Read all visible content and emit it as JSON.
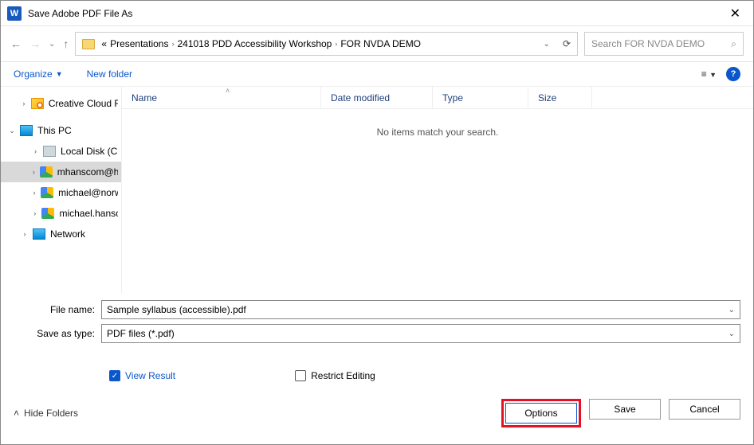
{
  "titlebar": {
    "title": "Save Adobe PDF File As"
  },
  "breadcrumb": {
    "prefix": "«",
    "items": [
      "Presentations",
      "241018 PDD Accessibility Workshop",
      "FOR NVDA DEMO"
    ]
  },
  "search": {
    "placeholder": "Search FOR NVDA DEMO"
  },
  "toolbar": {
    "organize": "Organize",
    "new_folder": "New folder"
  },
  "tree": {
    "items": [
      {
        "label": "Creative Cloud Files"
      },
      {
        "label": "This PC"
      },
      {
        "label": "Local Disk (C:)"
      },
      {
        "label": "mhanscom@highline.edu"
      },
      {
        "label": "michael@norwescon"
      },
      {
        "label": "michael.hanscom"
      },
      {
        "label": "Network"
      }
    ]
  },
  "file_list": {
    "columns": {
      "name": "Name",
      "date": "Date modified",
      "type": "Type",
      "size": "Size"
    },
    "empty": "No items match your search."
  },
  "fields": {
    "filename_label": "File name:",
    "filename": "Sample syllabus (accessible).pdf",
    "savetype_label": "Save as type:",
    "savetype": "PDF files (*.pdf)"
  },
  "checks": {
    "view_result": "View Result",
    "restrict": "Restrict Editing"
  },
  "bottom": {
    "hide_folders": "Hide Folders",
    "options": "Options",
    "save": "Save",
    "cancel": "Cancel"
  }
}
